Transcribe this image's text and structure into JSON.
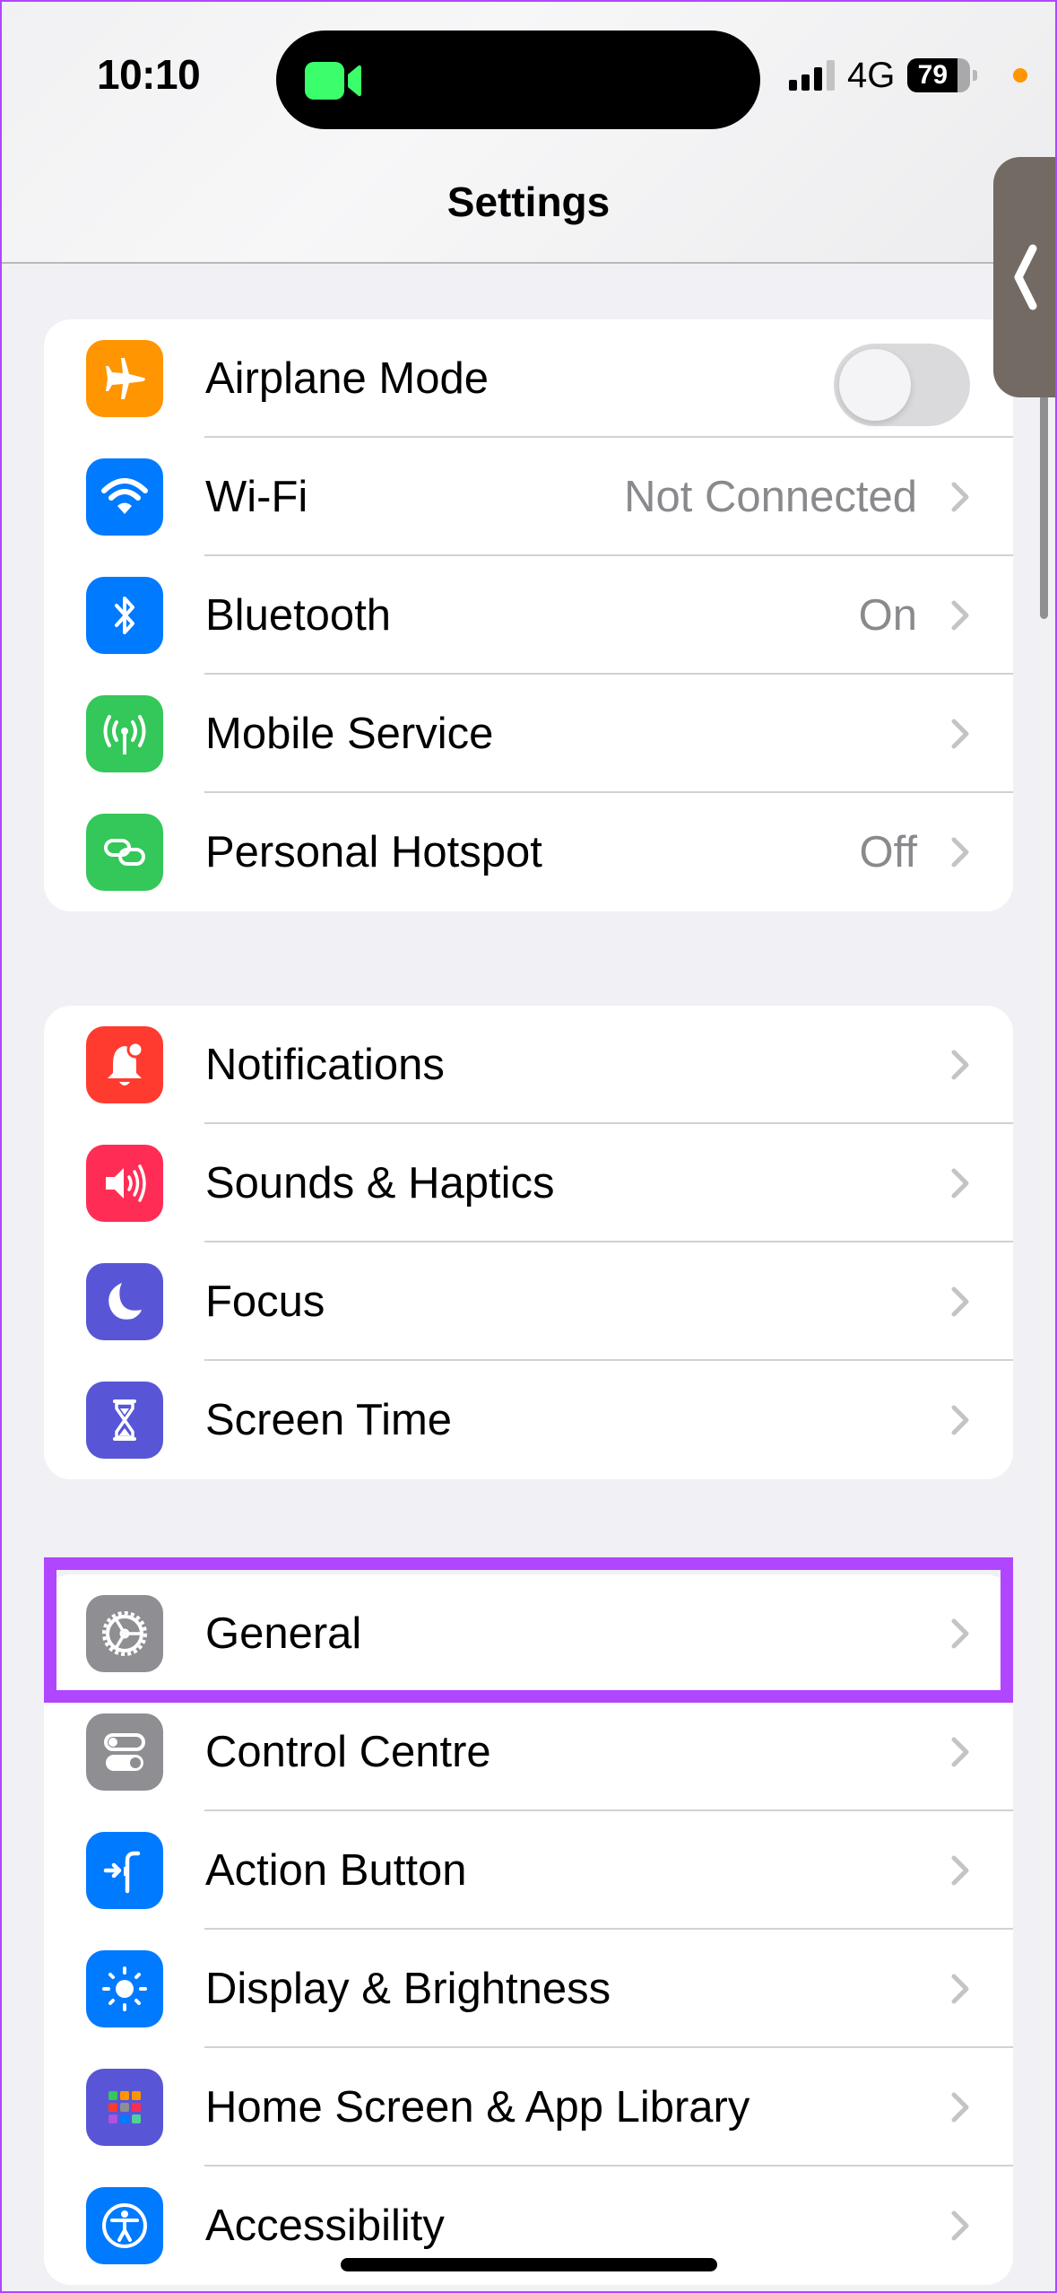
{
  "status_bar": {
    "time": "10:10",
    "network": "4G",
    "battery_percent": "79",
    "battery_level": 0.79,
    "signal_bars_filled": 3,
    "signal_bars_total": 4,
    "activity_icon": "facetime-video-icon",
    "indicator_dot_color": "#ff9500"
  },
  "header": {
    "title": "Settings"
  },
  "groups": [
    {
      "items": [
        {
          "label": "Airplane Mode",
          "icon": "airplane-icon",
          "color": "#ff9500",
          "control": "toggle",
          "toggle_on": false
        },
        {
          "label": "Wi-Fi",
          "icon": "wifi-icon",
          "color": "#007aff",
          "value": "Not Connected",
          "control": "chevron"
        },
        {
          "label": "Bluetooth",
          "icon": "bluetooth-icon",
          "color": "#007aff",
          "value": "On",
          "control": "chevron"
        },
        {
          "label": "Mobile Service",
          "icon": "antenna-icon",
          "color": "#34c759",
          "value": "",
          "control": "chevron"
        },
        {
          "label": "Personal Hotspot",
          "icon": "hotspot-link-icon",
          "color": "#34c759",
          "value": "Off",
          "control": "chevron"
        }
      ]
    },
    {
      "items": [
        {
          "label": "Notifications",
          "icon": "bell-icon",
          "color": "#ff3b30",
          "control": "chevron"
        },
        {
          "label": "Sounds & Haptics",
          "icon": "speaker-icon",
          "color": "#ff2d55",
          "control": "chevron"
        },
        {
          "label": "Focus",
          "icon": "moon-icon",
          "color": "#5856d6",
          "control": "chevron"
        },
        {
          "label": "Screen Time",
          "icon": "hourglass-icon",
          "color": "#5856d6",
          "control": "chevron"
        }
      ]
    },
    {
      "items": [
        {
          "label": "General",
          "icon": "gear-icon",
          "color": "#8e8e93",
          "control": "chevron",
          "highlighted": true
        },
        {
          "label": "Control Centre",
          "icon": "switches-icon",
          "color": "#8e8e93",
          "control": "chevron"
        },
        {
          "label": "Action Button",
          "icon": "action-button-icon",
          "color": "#007aff",
          "control": "chevron"
        },
        {
          "label": "Display & Brightness",
          "icon": "sun-icon",
          "color": "#007aff",
          "control": "chevron"
        },
        {
          "label": "Home Screen & App Library",
          "icon": "app-grid-icon",
          "color": "#5856d6",
          "control": "chevron"
        },
        {
          "label": "Accessibility",
          "icon": "accessibility-icon",
          "color": "#007aff",
          "control": "chevron"
        }
      ]
    }
  ],
  "annotation": {
    "highlight_color": "#b146ff",
    "highlighted_item": "General"
  },
  "side_tab": {
    "icon": "chevron-left-icon",
    "color": "#726a63"
  }
}
